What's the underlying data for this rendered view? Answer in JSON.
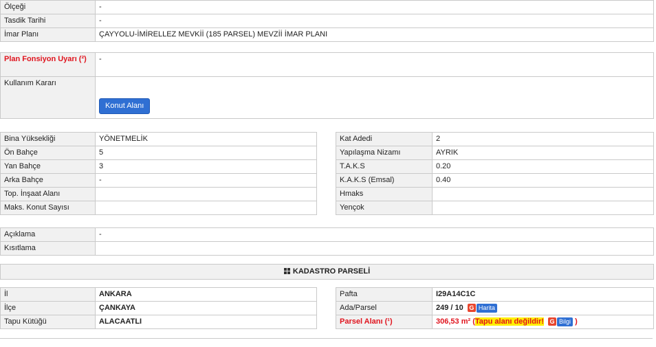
{
  "top": {
    "rows": [
      {
        "label": "Ölçeği",
        "value": "-"
      },
      {
        "label": "Tasdik Tarihi",
        "value": "-"
      },
      {
        "label": "İmar Planı",
        "value": "ÇAYYOLU-İMİRELLEZ MEVKİİ (185 PARSEL) MEVZİİ İMAR PLANI"
      }
    ]
  },
  "plan_fonksiyon": {
    "label": "Plan Fonsiyon Uyarı (²)",
    "value": "-"
  },
  "kullanim": {
    "label": "Kullanım Kararı",
    "button": "Konut Alanı"
  },
  "build_left": [
    {
      "label": "Bina Yüksekliği",
      "value": "YÖNETMELİK"
    },
    {
      "label": "Ön Bahçe",
      "value": "5"
    },
    {
      "label": "Yan Bahçe",
      "value": "3"
    },
    {
      "label": "Arka Bahçe",
      "value": "-"
    },
    {
      "label": "Top. İnşaat Alanı",
      "value": ""
    },
    {
      "label": "Maks. Konut Sayısı",
      "value": ""
    }
  ],
  "build_right": [
    {
      "label": "Kat Adedi",
      "value": "2"
    },
    {
      "label": "Yapılaşma Nizamı",
      "value": "AYRIK"
    },
    {
      "label": "T.A.K.S",
      "value": "0.20"
    },
    {
      "label": "K.A.K.S (Emsal)",
      "value": "0.40"
    },
    {
      "label": "Hmaks",
      "value": ""
    },
    {
      "label": "Yençok",
      "value": ""
    }
  ],
  "notes": [
    {
      "label": "Açıklama",
      "value": "-"
    },
    {
      "label": "Kısıtlama",
      "value": ""
    }
  ],
  "kadastro": {
    "title": "KADASTRO PARSELİ",
    "left": [
      {
        "label": "İl",
        "value": "ANKARA"
      },
      {
        "label": "İlçe",
        "value": "ÇANKAYA"
      },
      {
        "label": "Tapu Kütüğü",
        "value": "ALACAATLI"
      }
    ],
    "pafta": {
      "label": "Pafta",
      "value": "I29A14C1C"
    },
    "ada": {
      "label": "Ada/Parsel",
      "value": "249 / 10",
      "link": "Harita"
    },
    "alan": {
      "label": "Parsel Alanı (¹)",
      "value": "306,53 m²",
      "open": "(",
      "warning": "Tapu alanı değildir!",
      "link": "Bilgi",
      "close": ")"
    }
  },
  "colors": {
    "accent": "#2f6fd3",
    "warning": "#e0141e",
    "highlight": "#ffee00",
    "label_bg": "#f1f1f1"
  }
}
